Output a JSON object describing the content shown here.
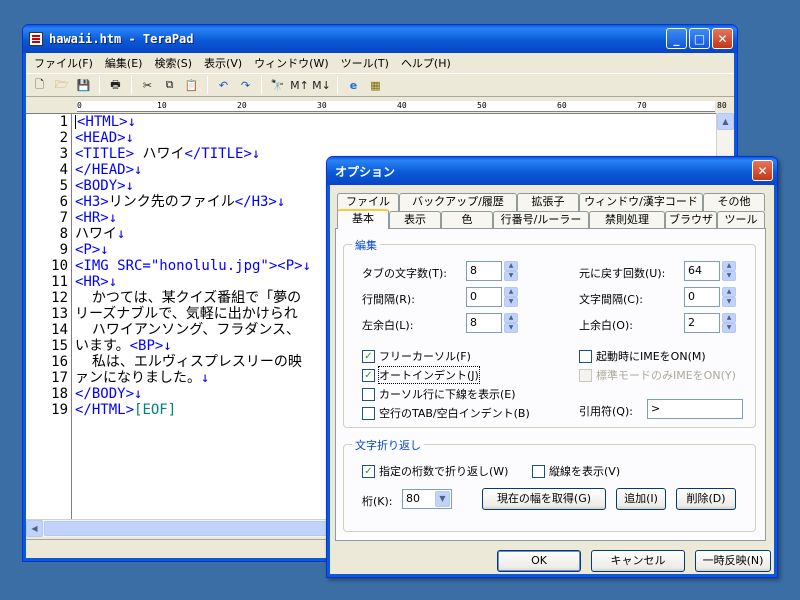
{
  "main_window": {
    "title": "hawaii.htm - TeraPad",
    "caption_minimize": "_",
    "caption_maximize": "□",
    "caption_close": "✕",
    "menu": [
      "ファイル(F)",
      "編集(E)",
      "検索(S)",
      "表示(V)",
      "ウィンドウ(W)",
      "ツール(T)",
      "ヘルプ(H)"
    ],
    "toolbar_icons": [
      "new-file-icon",
      "open-folder-icon",
      "save-icon",
      "print-icon",
      "cut-icon",
      "copy-icon",
      "paste-icon",
      "undo-icon",
      "redo-icon",
      "find-icon",
      "find-next-icon",
      "find-prev-icon",
      "browser-icon",
      "color-icon"
    ],
    "ruler_labels": [
      "0",
      "10",
      "20",
      "30",
      "40",
      "50",
      "60",
      "70",
      "80"
    ],
    "editor": {
      "line_numbers": [
        "1",
        "2",
        "3",
        "4",
        "5",
        "6",
        "7",
        "8",
        "9",
        "10",
        "11",
        "12",
        "13",
        "14",
        "15",
        "16",
        "17",
        "18",
        "19"
      ],
      "eol_mark": "↓",
      "eof_mark": "[EOF]"
    }
  },
  "options_dialog": {
    "title": "オプション",
    "close": "✕",
    "tabs_back": [
      "ファイル",
      "バックアップ/履歴",
      "拡張子",
      "ウィンドウ/漢字コード",
      "その他"
    ],
    "tabs_front": [
      "基本",
      "表示",
      "色",
      "行番号/ルーラー",
      "禁則処理",
      "ブラウザ",
      "ツール"
    ],
    "edit_group": {
      "label": "編集",
      "tab_width_label": "タブの文字数(T):",
      "tab_width": "8",
      "line_spacing_label": "行間隔(R):",
      "line_spacing": "0",
      "left_margin_label": "左余白(L):",
      "left_margin": "8",
      "undo_count_label": "元に戻す回数(U):",
      "undo_count": "64",
      "char_spacing_label": "文字間隔(C):",
      "char_spacing": "0",
      "top_margin_label": "上余白(O):",
      "top_margin": "2",
      "free_cursor": "フリーカーソル(F)",
      "auto_indent": "オートインデント(J)",
      "cursor_underline": "カーソル行に下線を表示(E)",
      "blank_tab_indent": "空行のTAB/空白インデント(B)",
      "ime_on_start": "起動時にIMEをON(M)",
      "ime_standard_mode": "標準モードのみIMEをON(Y)",
      "quote_label": "引用符(Q):",
      "quote_value": ">"
    },
    "wrap_group": {
      "label": "文字折り返し",
      "wrap_at_column": "指定の桁数で折り返し(W)",
      "show_vertical_line": "縦線を表示(V)",
      "column_label": "桁(K):",
      "column_value": "80",
      "get_width_button": "現在の幅を取得(G)",
      "add_button": "追加(I)",
      "delete_button": "削除(D)"
    },
    "buttons": {
      "ok": "OK",
      "cancel": "キャンセル",
      "apply": "一時反映(N)"
    }
  }
}
